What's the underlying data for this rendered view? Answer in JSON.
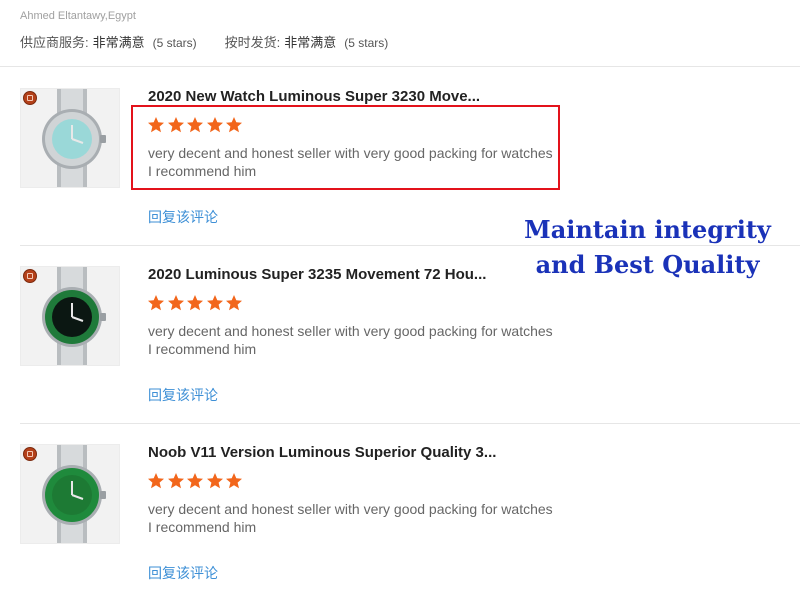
{
  "header": {
    "buyer": "Ahmed Eltantawy,Egypt",
    "ratings": [
      {
        "label": "供应商服务:",
        "value": "非常满意",
        "stars": "(5 stars)"
      },
      {
        "label": "按时发货:",
        "value": "非常满意",
        "stars": "(5 stars)"
      }
    ]
  },
  "reviews": [
    {
      "title": "2020 New Watch Luminous Super 3230 Move...",
      "rating": 5,
      "comment_line1": "very decent and honest seller with very good packing for watches",
      "comment_line2": "I recommend him",
      "reply": "回复该评论",
      "dial_color": "#9ad8d8",
      "bezel_color": "#d0d4d6"
    },
    {
      "title": "2020 Luminous Super 3235 Movement 72 Hou...",
      "rating": 5,
      "comment_line1": "very decent and honest seller with very good packing for watches",
      "comment_line2": "I recommend him",
      "reply": "回复该评论",
      "dial_color": "#0b1712",
      "bezel_color": "#1f7a3a"
    },
    {
      "title": "Noob V11 Version Luminous Superior Quality 3...",
      "rating": 5,
      "comment_line1": "very decent and honest seller with very good packing for watches",
      "comment_line2": "I recommend him",
      "reply": "回复该评论",
      "dial_color": "#1d7a34",
      "bezel_color": "#1f8a3c"
    }
  ],
  "overlay": {
    "line1": "Maintain integrity",
    "line2": "and Best Quality"
  },
  "colors": {
    "star": "#f2661b",
    "highlight": "#e3121b",
    "overlay_text": "#1a32b8",
    "reply_link": "#3d8fd6"
  }
}
